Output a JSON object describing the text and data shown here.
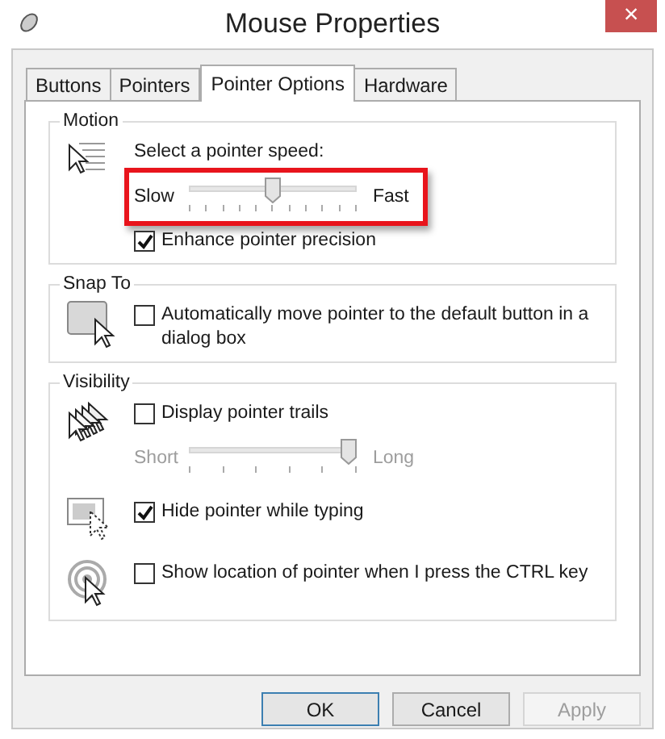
{
  "window": {
    "title": "Mouse Properties",
    "close": "×"
  },
  "tabs": [
    {
      "label": "Buttons",
      "selected": false
    },
    {
      "label": "Pointers",
      "selected": false
    },
    {
      "label": "Pointer Options",
      "selected": true
    },
    {
      "label": "Hardware",
      "selected": false
    }
  ],
  "groups": [
    {
      "title": "Motion",
      "rows": [
        {
          "items": [
            {
              "kind": "label",
              "text": "Select a pointer speed:"
            },
            {
              "kind": "slider",
              "min_label": "Slow",
              "max_label": "Fast",
              "level": 0.5,
              "disabled": false,
              "highlighted": true
            },
            {
              "kind": "checkbox",
              "label": "Enhance pointer precision",
              "checked": true
            }
          ]
        }
      ]
    },
    {
      "title": "Snap To",
      "rows": [
        {
          "items": [
            {
              "kind": "checkbox",
              "label": "Automatically move pointer to the default button in a dialog box",
              "checked": false
            }
          ]
        }
      ]
    },
    {
      "title": "Visibility",
      "rows": [
        {
          "items": [
            {
              "kind": "checkbox",
              "label": "Display pointer trails",
              "checked": false
            },
            {
              "kind": "slider",
              "min_label": "Short",
              "max_label": "Long",
              "level": 1,
              "disabled": true,
              "highlighted": false
            }
          ]
        },
        {
          "items": [
            {
              "kind": "checkbox",
              "label": "Hide pointer while typing",
              "checked": true
            }
          ]
        },
        {
          "items": [
            {
              "kind": "checkbox",
              "label": "Show location of pointer when I press the CTRL key",
              "checked": false
            }
          ]
        }
      ]
    }
  ],
  "buttons": [
    {
      "label": "OK",
      "default": true,
      "disabled": false
    },
    {
      "label": "Cancel",
      "default": false,
      "disabled": false
    },
    {
      "label": "Apply",
      "default": false,
      "disabled": true
    }
  ]
}
